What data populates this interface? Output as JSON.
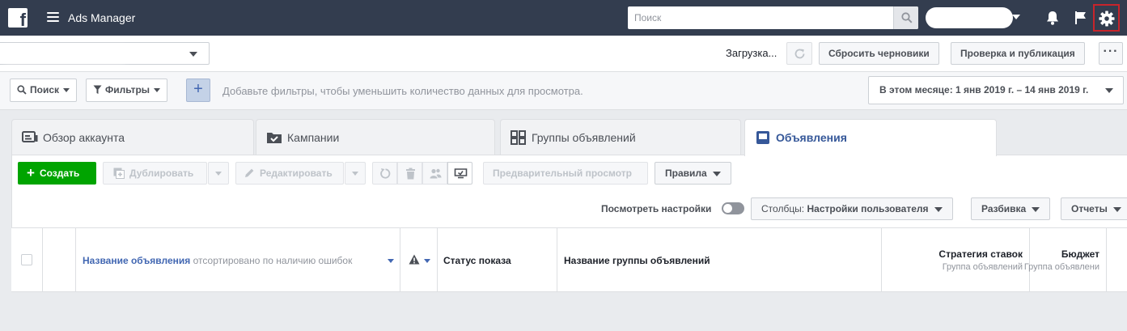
{
  "topbar": {
    "logo_letter": "f",
    "app_title": "Ads Manager",
    "search_placeholder": "Поиск",
    "icons": [
      "facebook-logo",
      "menu-icon",
      "search-icon",
      "bell-icon",
      "flag-icon",
      "gear-icon"
    ]
  },
  "toolbar": {
    "loading_label": "Загрузка...",
    "discard_label": "Сбросить черновики",
    "review_label": "Проверка и публикация",
    "more_label": "···"
  },
  "filters": {
    "search_label": "Поиск",
    "filters_label": "Фильтры",
    "add_label": "+",
    "hint": "Добавьте фильтры, чтобы уменьшить количество данных для просмотра.",
    "date_range_label": "В этом месяце: 1 янв 2019 г. – 14 янв 2019 г."
  },
  "tabs": [
    {
      "label": "Обзор аккаунта",
      "active": false
    },
    {
      "label": "Кампании",
      "active": false
    },
    {
      "label": "Группы объявлений",
      "active": false
    },
    {
      "label": "Объявления",
      "active": true
    }
  ],
  "actions": {
    "create_label": "Создать",
    "duplicate_label": "Дублировать",
    "edit_label": "Редактировать",
    "preview_label": "Предварительный просмотр",
    "rules_label": "Правила"
  },
  "view": {
    "settings_label": "Посмотреть настройки",
    "settings_toggle_on": false,
    "columns_prefix": "Столбцы:",
    "columns_value": "Настройки пользователя",
    "breakdown_label": "Разбивка",
    "reports_label": "Отчеты"
  },
  "table": {
    "name_header": "Название объявления",
    "name_sort_note": "отсортировано по наличию ошибок",
    "status_header": "Статус показа",
    "adset_name_header": "Название группы объявлений",
    "bid_strategy_header": "Стратегия ставок",
    "bid_strategy_sub": "Группа объявлений",
    "budget_header": "Бюджет",
    "budget_sub": "Группа объявлени"
  },
  "colors": {
    "topbar_bg": "#333d4f",
    "create_green": "#00a400",
    "link_blue": "#4267b2",
    "active_tab_text": "#365899",
    "highlight_red": "#c7242b"
  }
}
